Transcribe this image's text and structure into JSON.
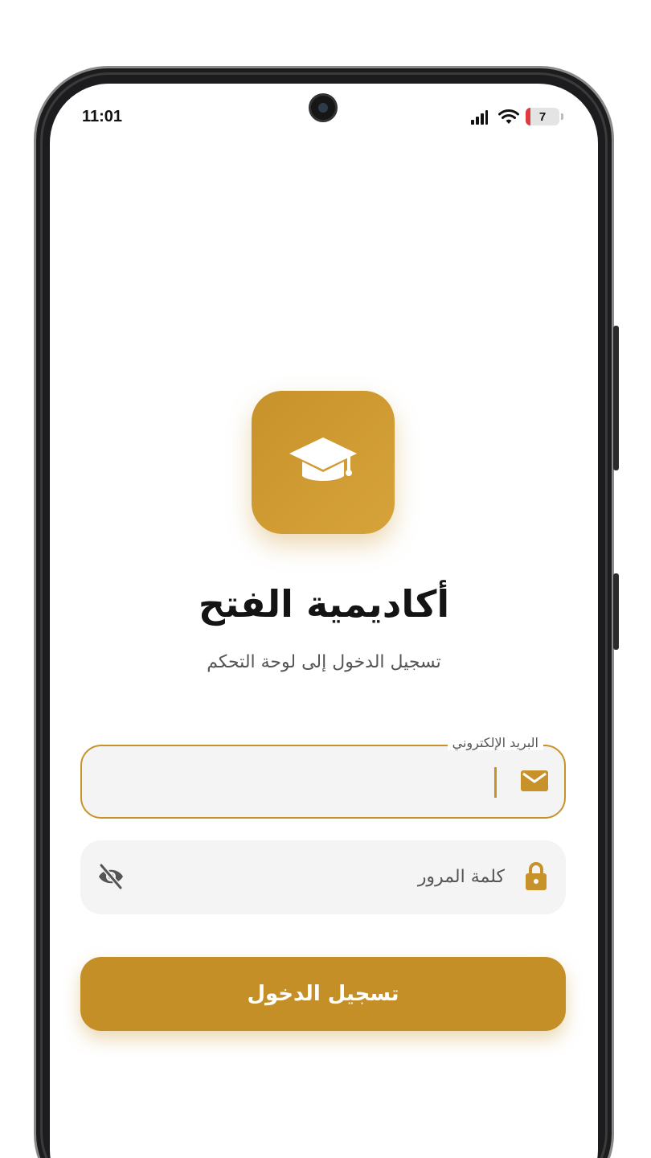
{
  "status_bar": {
    "time": "11:01",
    "battery_level": "7",
    "signal_icon": "cellular-signal-icon",
    "wifi_icon": "wifi-icon"
  },
  "brand": {
    "logo_icon": "graduation-cap-icon",
    "title": "أكاديمية الفتح",
    "subtitle": "تسجيل الدخول إلى لوحة التحكم"
  },
  "form": {
    "email": {
      "label": "البريد الإلكتروني",
      "value": "",
      "icon": "envelope-icon"
    },
    "password": {
      "placeholder": "كلمة المرور",
      "value": "",
      "icon": "lock-icon",
      "toggle_icon": "eye-off-icon"
    },
    "submit_label": "تسجيل الدخول"
  },
  "colors": {
    "accent": "#c8922a",
    "button": "#c48f26",
    "field_background": "#f4f4f4"
  }
}
